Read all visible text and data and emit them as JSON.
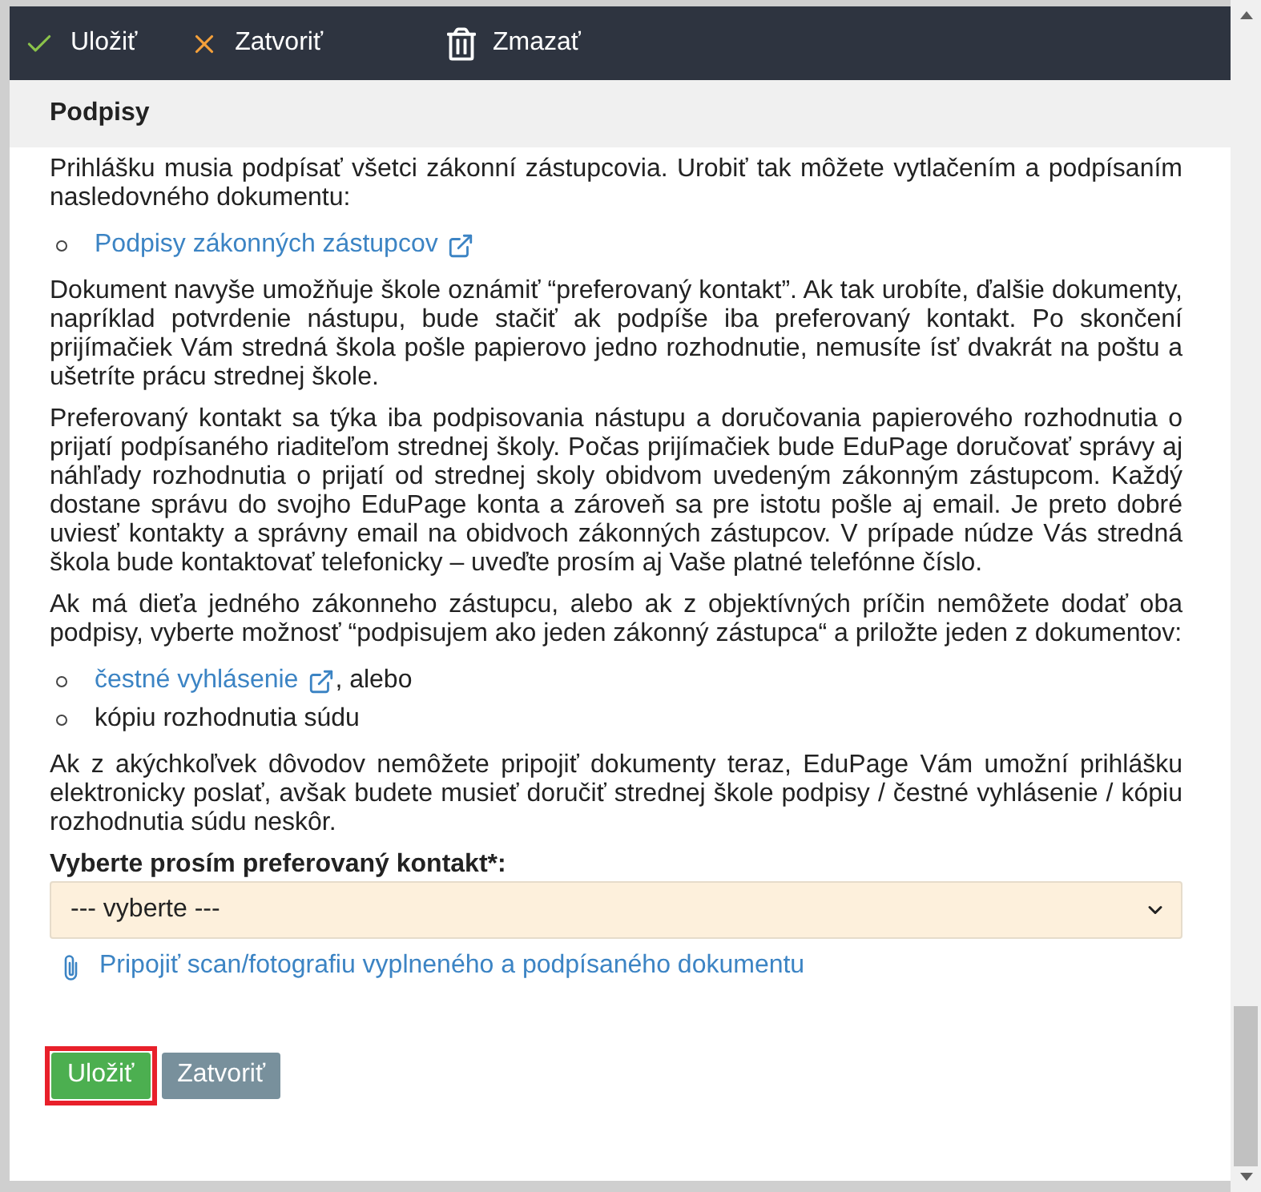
{
  "toolbar": {
    "buttons": [
      {
        "kind": "save",
        "label": "Uložiť"
      },
      {
        "kind": "close",
        "label": "Zatvoriť"
      },
      {
        "kind": "delete",
        "label": "Zmazať"
      }
    ]
  },
  "section": {
    "title": "Podpisy"
  },
  "blocks": [
    {
      "kind": "paragraph",
      "text": "Prihlášku musia podpísať všetci zákonní zástupcovia. Urobiť tak môžete vytlačením a podpísaním nasledovného dokumentu:"
    },
    {
      "kind": "list",
      "items": [
        {
          "kind": "link",
          "label": "Podpisy zákonných zástupcov",
          "external": true
        }
      ]
    },
    {
      "kind": "paragraph",
      "text": "Dokument navyše umožňuje škole oznámiť “preferovaný kontakt”. Ak tak urobíte, ďalšie dokumenty, napríklad potvrdenie nástupu, bude stačiť ak podpíše iba preferovaný kontakt. Po skončení prijímačiek Vám stredná škola pošle papierovo jedno rozhodnutie, nemusíte ísť dvakrát na poštu a ušetríte prácu strednej škole."
    },
    {
      "kind": "paragraph",
      "text": "Preferovaný kontakt sa týka iba podpisovania nástupu a doručovania papierového rozhodnutia o prijatí podpísaného riaditeľom strednej školy. Počas prijímačiek bude EduPage doručovať správy aj náhľady rozhodnutia o prijatí od strednej skoly obidvom uvedeným zákonným zástupcom. Každý dostane správu do svojho EduPage konta a zároveň sa pre istotu pošle aj email. Je preto dobré uviesť kontakty a správny email na obidvoch zákonných zástupcov. V prípade núdze Vás stredná škola bude kontaktovať telefonicky – uveďte prosím aj Vaše platné telefónne číslo."
    },
    {
      "kind": "paragraph",
      "text": "Ak má dieťa jedného zákonneho zástupcu, alebo ak z objektívných príčin nemôžete dodať oba podpisy, vyberte možnosť “podpisujem ako jeden zákonný zástupca“ a priložte jeden z dokumentov:"
    },
    {
      "kind": "list",
      "items": [
        {
          "kind": "link",
          "label": "čestné vyhlásenie",
          "external": true,
          "suffix": ", alebo"
        },
        {
          "kind": "text",
          "text": "kópiu rozhodnutia súdu"
        }
      ]
    },
    {
      "kind": "paragraph",
      "text": "Ak z akýchkoľvek dôvodov nemôžete pripojiť dokumenty teraz, EduPage Vám umožní prihlášku elektronicky poslať, avšak budete musieť doručiť strednej škole podpisy / čestné vyhlásenie / kópiu rozhodnutia súdu neskôr."
    }
  ],
  "contact_field": {
    "label": "Vyberte prosím preferovaný kontakt*:",
    "value": "--- vyberte ---"
  },
  "attach_link": {
    "label": "Pripojiť scan/fotografiu vyplneného a podpísaného dokumentu"
  },
  "footer_buttons": [
    {
      "kind": "save",
      "label": "Uložiť",
      "highlighted": true
    },
    {
      "kind": "close",
      "label": "Zatvoriť",
      "highlighted": false
    }
  ]
}
